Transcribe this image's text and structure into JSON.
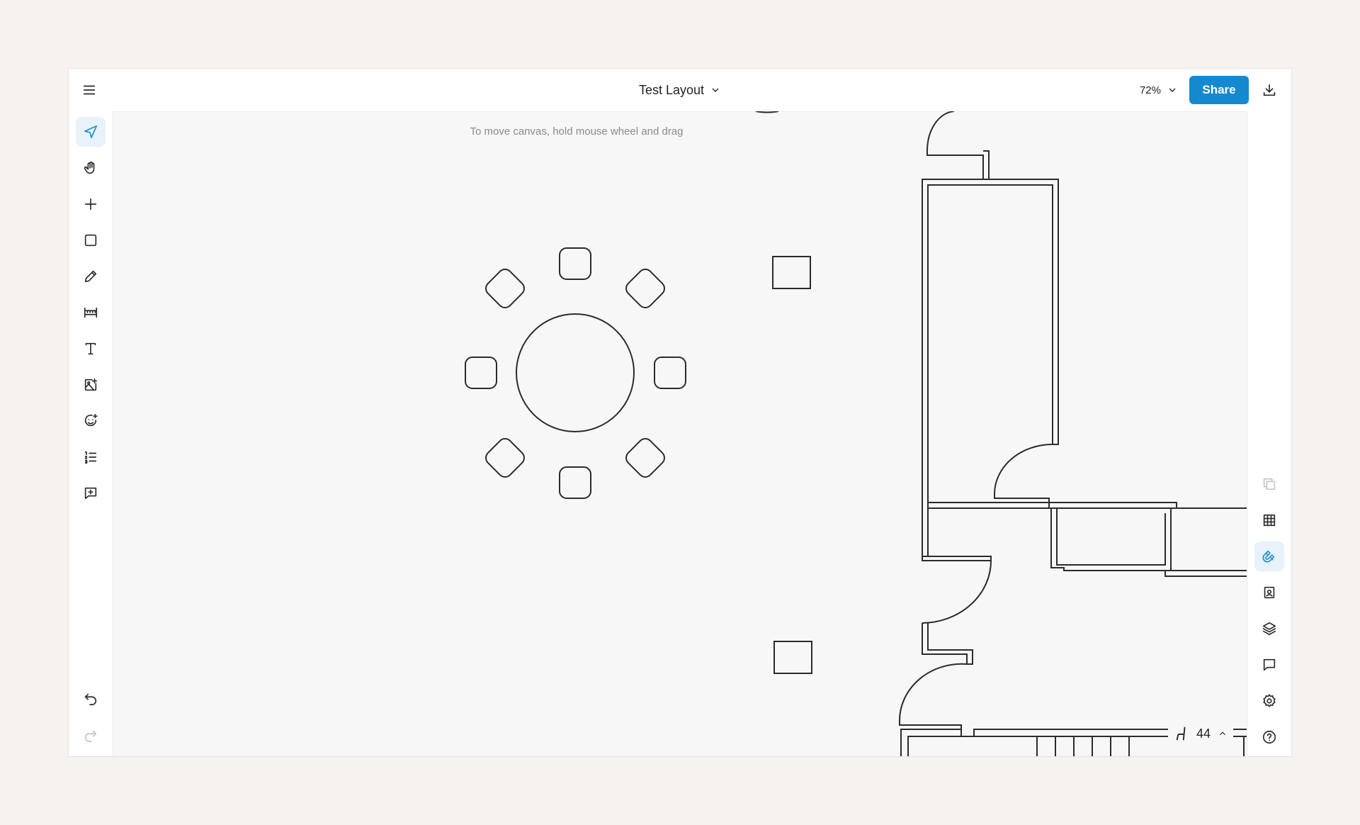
{
  "document": {
    "title": "Test Layout"
  },
  "zoom": {
    "value": "72%"
  },
  "share": {
    "label": "Share"
  },
  "canvas": {
    "hint": "To move canvas, hold mouse wheel and drag"
  },
  "seats": {
    "count": "44"
  },
  "accent_color": "#1589cf",
  "left_tools": [
    {
      "name": "select-tool",
      "icon": "navigation-arrow-icon",
      "active": true
    },
    {
      "name": "pan-tool",
      "icon": "hand-icon"
    },
    {
      "name": "add-tool",
      "icon": "plus-icon"
    },
    {
      "name": "shape-tool",
      "icon": "square-icon"
    },
    {
      "name": "draw-tool",
      "icon": "pencil-icon"
    },
    {
      "name": "measure-tool",
      "icon": "ruler-icon"
    },
    {
      "name": "text-tool",
      "icon": "text-icon"
    },
    {
      "name": "image-tool",
      "icon": "image-plus-icon"
    },
    {
      "name": "emoji-tool",
      "icon": "smiley-icon"
    },
    {
      "name": "list-tool",
      "icon": "numbered-list-icon"
    },
    {
      "name": "comment-tool",
      "icon": "comment-plus-icon"
    }
  ],
  "right_tools": [
    {
      "name": "duplicate",
      "icon": "copy-icon",
      "disabled": true
    },
    {
      "name": "grid",
      "icon": "grid-icon"
    },
    {
      "name": "snap",
      "icon": "magnet-icon",
      "active": true
    },
    {
      "name": "guests",
      "icon": "contact-icon"
    },
    {
      "name": "layers",
      "icon": "layers-icon"
    },
    {
      "name": "comments",
      "icon": "chat-icon"
    },
    {
      "name": "settings",
      "icon": "gear-icon"
    },
    {
      "name": "help",
      "icon": "help-icon"
    }
  ]
}
